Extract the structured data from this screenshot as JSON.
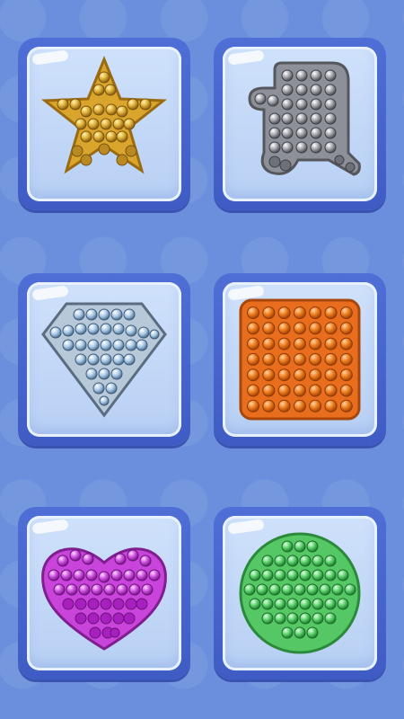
{
  "colors": {
    "background": "#6b8fdc",
    "tile_frame": "#4a68d0",
    "tile_inner": "#c7dcf8"
  },
  "toys": [
    {
      "name": "star",
      "color": "#e0b23a",
      "icon": "star-pop-it-icon"
    },
    {
      "name": "ghost",
      "color": "#9a9ca3",
      "icon": "ghost-pop-it-icon"
    },
    {
      "name": "diamond",
      "color": "#8fb8d8",
      "icon": "diamond-pop-it-icon"
    },
    {
      "name": "square",
      "color": "#e76a1d",
      "icon": "square-pop-it-icon"
    },
    {
      "name": "heart",
      "color": "#c63bd8",
      "icon": "heart-pop-it-icon"
    },
    {
      "name": "circle",
      "color": "#5fcf6e",
      "icon": "circle-pop-it-icon"
    }
  ]
}
